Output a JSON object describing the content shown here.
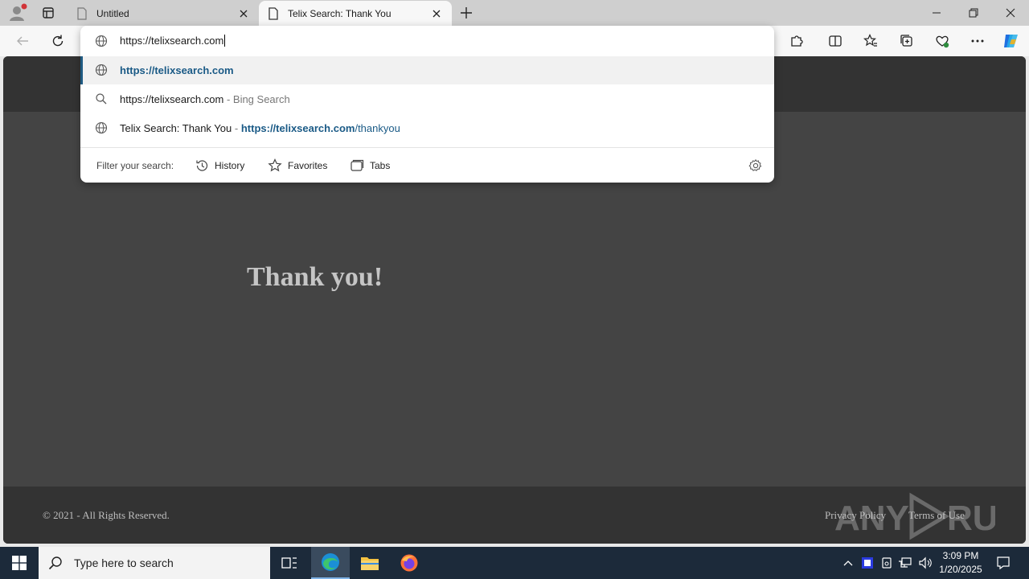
{
  "tabs": [
    {
      "title": "Untitled",
      "active": false
    },
    {
      "title": "Telix Search: Thank You",
      "active": true
    }
  ],
  "omnibox": {
    "input_value": "https://telixsearch.com",
    "suggestions": [
      {
        "icon": "globe-icon",
        "text": "https://telixsearch.com",
        "selected": true
      },
      {
        "icon": "search-icon",
        "text": "https://telixsearch.com",
        "suffix": "- Bing Search"
      },
      {
        "icon": "globe-icon",
        "text": "Telix Search: Thank You",
        "sep": "-",
        "url_bold": "https://telixsearch.com",
        "url_rest": "/thankyou"
      }
    ],
    "filter_label": "Filter your search:",
    "filters": [
      {
        "icon": "history-icon",
        "label": "History"
      },
      {
        "icon": "star-icon",
        "label": "Favorites"
      },
      {
        "icon": "tabs-icon",
        "label": "Tabs"
      }
    ]
  },
  "page": {
    "heading": "Thank you!",
    "copyright": "© 2021 - All Rights Reserved.",
    "links": [
      "Privacy Policy",
      "Terms of Use"
    ],
    "watermark": "ANY RUN",
    "background": "#444444",
    "header_footer_color": "#333333"
  },
  "taskbar": {
    "search_placeholder": "Type here to search",
    "time": "3:09 PM",
    "date": "1/20/2025"
  },
  "colors": {
    "accent_link": "#1a5a86",
    "taskbar": "#1c2a3a"
  }
}
